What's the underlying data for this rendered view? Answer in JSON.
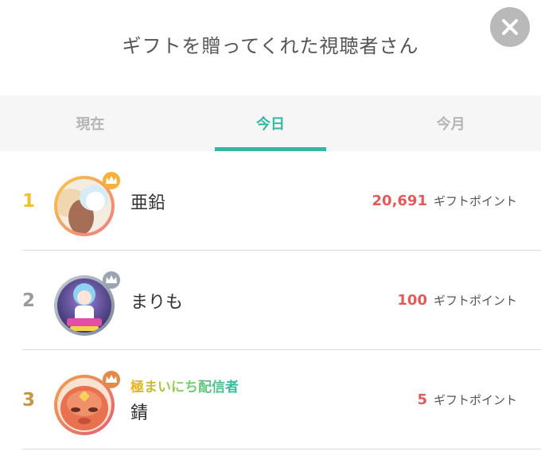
{
  "header": {
    "title": "ギフトを贈ってくれた視聴者さん"
  },
  "tabs": [
    {
      "label": "現在",
      "active": false
    },
    {
      "label": "今日",
      "active": true
    },
    {
      "label": "今月",
      "active": false
    }
  ],
  "ranking": [
    {
      "rank": "1",
      "name": "亜鉛",
      "badge": "",
      "points": "20,691",
      "unit": "ギフトポイント",
      "rank_color": "#efc12c",
      "ring_color": "#f4b23a"
    },
    {
      "rank": "2",
      "name": "まりも",
      "badge": "",
      "points": "100",
      "unit": "ギフトポイント",
      "rank_color": "#9a9a9a",
      "ring_color": "#9aa4b3"
    },
    {
      "rank": "3",
      "name": "錆",
      "badge": "極まいにち配信者",
      "points": "5",
      "unit": "ギフトポイント",
      "rank_color": "#c59548",
      "ring_color": "#e28a4a"
    }
  ],
  "colors": {
    "accent": "#33b9a0",
    "points": "#e45a5a"
  }
}
